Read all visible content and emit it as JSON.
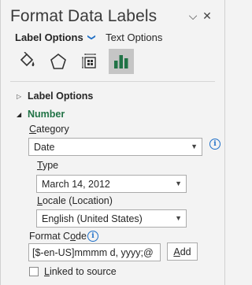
{
  "pane": {
    "title": "Format Data Labels",
    "collapse_glyph": "⌵",
    "close_glyph": "✕"
  },
  "tabs": {
    "label_options": "Label Options",
    "label_options_chevron": "❯",
    "text_options": "Text Options"
  },
  "icons": [
    "fill-line-icon",
    "effects-icon",
    "size-properties-icon",
    "label-options-icon"
  ],
  "sections": {
    "label_options": {
      "title": "Label Options",
      "arrow": "▷"
    },
    "number": {
      "title": "Number",
      "arrow": "◢"
    }
  },
  "number": {
    "category_label_pre": "",
    "category_label_u": "C",
    "category_label_post": "ategory",
    "category_value": "Date",
    "type_label_pre": "",
    "type_label_u": "T",
    "type_label_post": "ype",
    "type_value": "March 14, 2012",
    "locale_label_pre": "",
    "locale_label_u": "L",
    "locale_label_post": "ocale (Location)",
    "locale_value": "English (United States)",
    "format_code_label_pre": "Format C",
    "format_code_label_u": "o",
    "format_code_label_post": "de",
    "format_code_value": "[$-en-US]mmmm d, yyyy;@",
    "add_pre": "",
    "add_u": "A",
    "add_post": "dd",
    "linked_pre": "",
    "linked_u": "L",
    "linked_post": "inked to source",
    "linked_checked": false
  },
  "dropdown_arrow": "▼",
  "info_glyph": "i",
  "colors": {
    "accent_green": "#217346",
    "info_blue": "#1e6fc8",
    "selected_icon_bg": "#c5c5c5"
  }
}
